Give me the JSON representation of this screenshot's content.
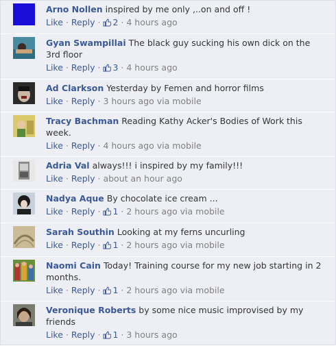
{
  "colors": {
    "background": "#edeff4",
    "author": "#3b5998",
    "text": "#333333",
    "meta": "#808080"
  },
  "labels": {
    "like": "Like",
    "reply": "Reply",
    "dot": "·"
  },
  "comments": [
    {
      "author": "Arno Nollen",
      "text": "inspired by me only ,..on and off !",
      "likes": "2",
      "time": "4 hours ago",
      "via": "",
      "avatar_icon": "blue-square-avatar"
    },
    {
      "author": "Gyan Swampillai",
      "text": "The black guy sucking his own dick on the 3rd floor",
      "likes": "3",
      "time": "4 hours ago",
      "via": "",
      "avatar_icon": "photo-avatar"
    },
    {
      "author": "Ad Clarkson",
      "text": "Yesterday by Femen and horror films",
      "likes": "",
      "time": "3 hours ago",
      "via": "via mobile",
      "avatar_icon": "photo-avatar"
    },
    {
      "author": "Tracy Bachman",
      "text": "Reading Kathy Acker's Bodies of Work this week.",
      "likes": "",
      "time": "4 hours ago",
      "via": "via mobile",
      "avatar_icon": "photo-avatar"
    },
    {
      "author": "Adria Val",
      "text": "always!!! i inspired by my family!!!",
      "likes": "",
      "time": "about an hour ago",
      "via": "",
      "avatar_icon": "photo-avatar"
    },
    {
      "author": "Nadya Aque",
      "text": "By chocolate ice cream ...",
      "likes": "1",
      "time": "2 hours ago",
      "via": "via mobile",
      "avatar_icon": "photo-avatar"
    },
    {
      "author": "Sarah Southin",
      "text": "Looking at my ferns uncurling",
      "likes": "1",
      "time": "2 hours ago",
      "via": "via mobile",
      "avatar_icon": "photo-avatar"
    },
    {
      "author": "Naomi Cain",
      "text": "Today! Training course for my new job starting in 2 months.",
      "likes": "1",
      "time": "2 hours ago",
      "via": "via mobile",
      "avatar_icon": "photo-avatar"
    },
    {
      "author": "Veronique Roberts",
      "text": "by some nice music improvised by my friends",
      "likes": "1",
      "time": "3 hours ago",
      "via": "",
      "avatar_icon": "photo-avatar"
    }
  ]
}
